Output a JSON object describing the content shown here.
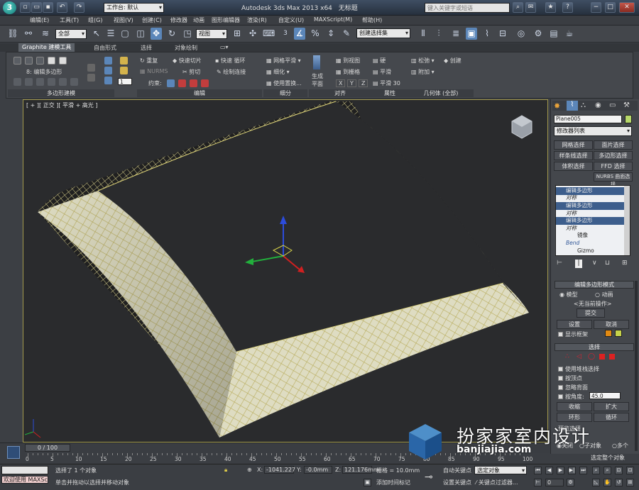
{
  "window": {
    "title": "Autodesk 3ds Max  2013 x64",
    "file_name": "无标题",
    "workspace": "工作台: 默认",
    "search_placeholder": "键入关键字或短语",
    "help_label": "?"
  },
  "menubar": [
    "编辑(E)",
    "工具(T)",
    "组(G)",
    "视图(V)",
    "创建(C)",
    "修改器",
    "动画",
    "图形编辑器",
    "渲染(R)",
    "自定义(U)",
    "MAXScript(M)",
    "帮助(H)"
  ],
  "toolbar": {
    "selection_filter": "全部",
    "ref_coord": "视图",
    "named_selection": "创建选择集",
    "snap_label": "3"
  },
  "ribbon": {
    "tabs": [
      "Graphite 建模工具",
      "自由形式",
      "选择",
      "对象绘制"
    ],
    "mode_label": "8: 编辑多边形",
    "groups": {
      "poly_modeling": "多边形建模",
      "edit": "编辑",
      "subdivide": "细分",
      "align": "对齐",
      "properties": "属性",
      "geometry": "几何体 (全部)"
    },
    "edit_items": [
      "重复",
      "快速切片",
      "快速 循环",
      "NURMS",
      "剪切",
      "绘制连接",
      "约束:"
    ],
    "subdivide_items": [
      "网格平滑",
      "细化",
      "使用置换..."
    ],
    "align_items": [
      "生成",
      "平面",
      "到视图",
      "到栅格",
      "X",
      "Y",
      "Z"
    ],
    "properties_items": [
      "硬",
      "平滑",
      "平滑 30"
    ],
    "geometry_items": [
      "松弛",
      "创建",
      "附加"
    ],
    "spinner_value": "1"
  },
  "viewport": {
    "label": "[ + ][ 正交 ][ 平滑 + 高光 ]"
  },
  "command_panel": {
    "object_name": "Plane005",
    "object_color": "#b7d86a",
    "modifier_list": "修改器列表",
    "buttons": [
      "网格选择",
      "面片选择",
      "样条线选择",
      "多边形选择",
      "体积选择",
      "FFD 选择",
      "NURBS 曲面选择"
    ],
    "stack": [
      {
        "label": "编辑多边形",
        "style": "sel"
      },
      {
        "label": "对称",
        "style": "ital"
      },
      {
        "label": "编辑多边形",
        "style": "ital"
      },
      {
        "label": "对称",
        "style": "ital"
      },
      {
        "label": "编辑多边形",
        "style": "ital"
      },
      {
        "label": "对称",
        "style": "ital"
      },
      {
        "label": "镜像",
        "style": "indent"
      },
      {
        "label": "Bend",
        "style": "ital"
      },
      {
        "label": "Gizmo",
        "style": "indent"
      }
    ],
    "rollout_edit_poly": "编辑多边形模式",
    "model_label": "模型",
    "anim_label": "动画",
    "no_op": "<无当前操作>",
    "commit": "提交",
    "settings": "设置",
    "cancel": "取消",
    "show_cage": "显示框架",
    "cage_color_1": "#e28a12",
    "cage_color_2": "#c6d24a",
    "rollout_select": "选择",
    "by_vertex": "使用堆栈选择",
    "by_vertex2": "按顶点",
    "ignore_back": "忽略背面",
    "by_angle": "按角度:",
    "angle_value": "45.0",
    "shrink": "收缩",
    "grow": "扩大",
    "ring": "环形",
    "loop": "循环",
    "preview": "预览选择",
    "off": "关闭",
    "subobj": "子对象",
    "multi": "多个",
    "selected_whole": "选定整个对象"
  },
  "timeline": {
    "slider": "0 / 100",
    "ticks": [
      "0",
      "5",
      "10",
      "15",
      "20",
      "25",
      "30",
      "35",
      "40",
      "45",
      "50",
      "55",
      "60",
      "65",
      "70",
      "75",
      "80",
      "85",
      "90",
      "95",
      "100"
    ]
  },
  "status": {
    "script_label": "欢迎使用 MAXSc",
    "selected": "选择了 1 个对象",
    "prompt": "单击并拖动以选择并移动对象",
    "x_label": "X:",
    "x_value": "-1041.227",
    "y_label": "Y:",
    "y_value": "-0.0mm",
    "z_label": "Z:",
    "z_value": "121.176mm",
    "grid": "栅格 = 10.0mm",
    "add_time_tag": "添加时间标记",
    "auto_key": "自动关键点",
    "set_key": "设置关键点",
    "key_mode": "选定对象",
    "key_filters": "关键点过滤器...",
    "frame": "0"
  },
  "watermark": {
    "brand": "扮家家室内设计",
    "url": "banjiajia.com"
  }
}
